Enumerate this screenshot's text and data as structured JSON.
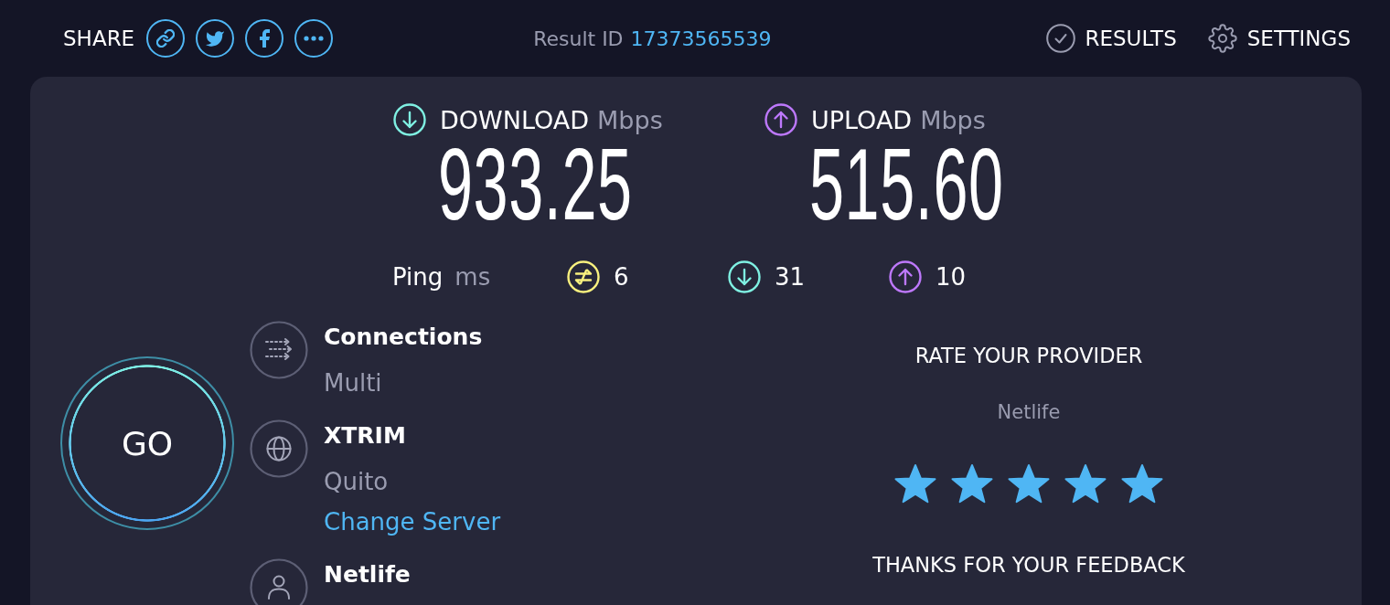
{
  "header": {
    "share_label": "SHARE",
    "result_id": {
      "label": "Result ID",
      "value": "17373565539"
    },
    "results_button": {
      "label": "RESULTS"
    },
    "settings_button": {
      "label": "SETTINGS"
    }
  },
  "speeds": [
    {
      "kind": "download",
      "label": "DOWNLOAD",
      "unit": "Mbps",
      "value": "933.25",
      "color": "#7ff0e2"
    },
    {
      "kind": "upload",
      "label": "UPLOAD",
      "unit": "Mbps",
      "value": "515.60",
      "color": "#bd78fb"
    }
  ],
  "ping": {
    "label": "Ping",
    "unit": "ms",
    "readings": [
      {
        "kind": "unloaded",
        "value": "6",
        "color": "#f8f07e"
      },
      {
        "kind": "download",
        "value": "31",
        "color": "#7ff0e2"
      },
      {
        "kind": "upload",
        "value": "10",
        "color": "#bd78fb"
      }
    ]
  },
  "go_button": {
    "label": "GO"
  },
  "server_info": [
    {
      "kind": "connections",
      "title": "Connections",
      "subtitle": "Multi"
    },
    {
      "kind": "server",
      "title": "XTRIM",
      "subtitle": "Quito",
      "link": "Change Server"
    },
    {
      "kind": "provider",
      "title": "Netlife"
    }
  ],
  "rating": {
    "title": "RATE YOUR PROVIDER",
    "provider": "Netlife",
    "stars": 5,
    "message": "THANKS FOR YOUR FEEDBACK"
  }
}
